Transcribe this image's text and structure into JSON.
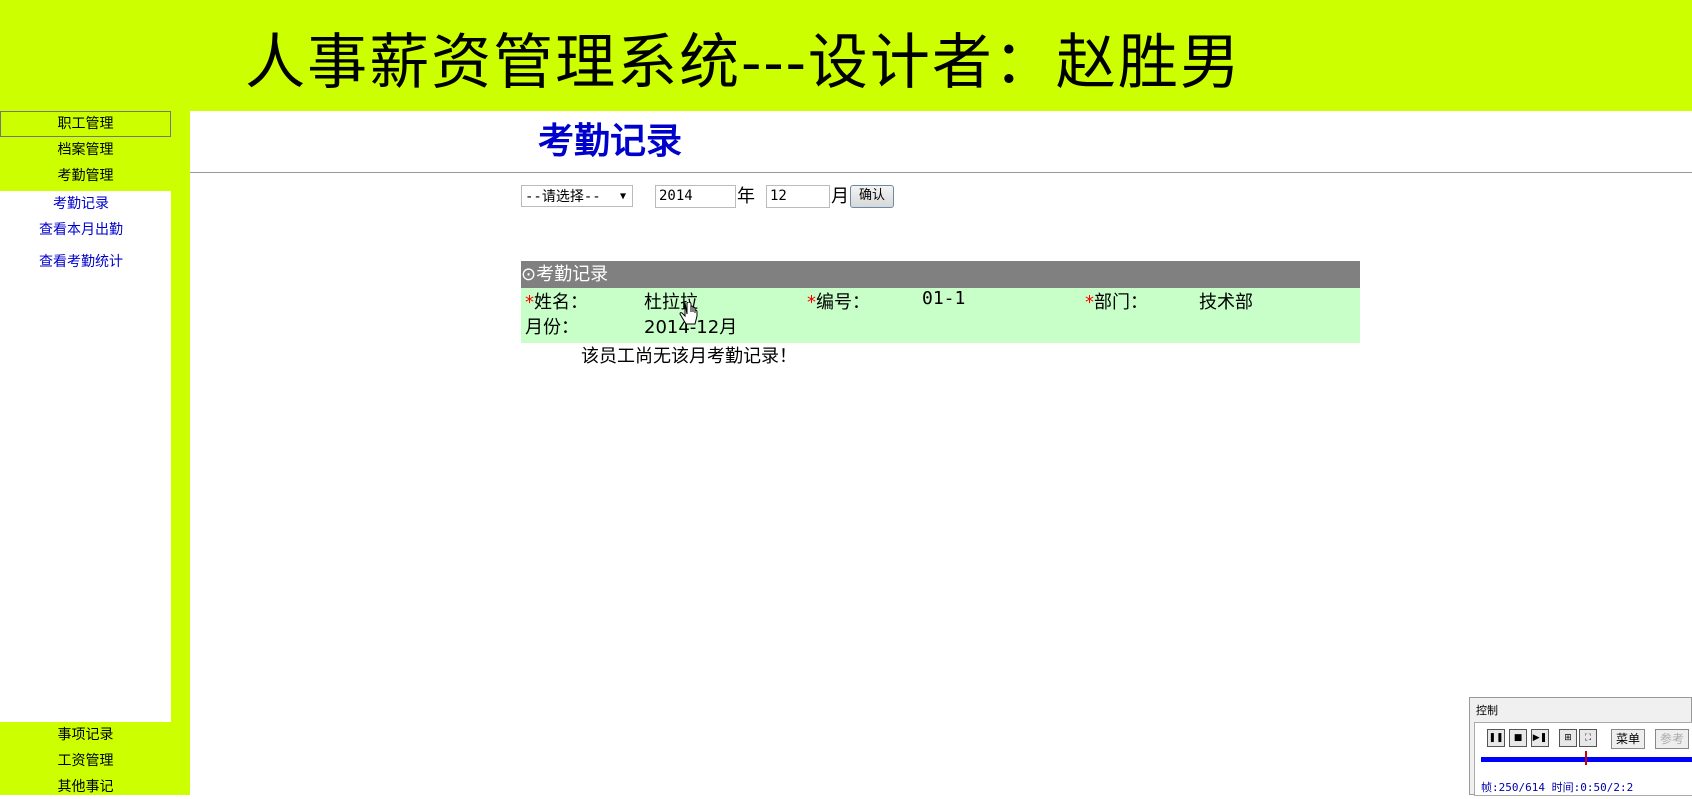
{
  "banner": {
    "title": "人事薪资管理系统---设计者：赵胜男"
  },
  "sidebar": {
    "top_items": [
      "职工管理",
      "档案管理",
      "考勤管理"
    ],
    "sub_items": [
      "考勤记录",
      "查看本月出勤",
      "查看考勤统计"
    ],
    "bottom_items": [
      "事项记录",
      "工资管理",
      "其他事记"
    ]
  },
  "main": {
    "title": "考勤记录",
    "select_value": "--请选择--",
    "year_value": "2014",
    "year_unit": "年",
    "month_value": "12",
    "month_unit": "月",
    "confirm_label": "确认"
  },
  "record": {
    "header": "⊙考勤记录",
    "name_label": "姓名：",
    "name_value": "杜拉拉",
    "id_label": "编号：",
    "id_value": "01-1",
    "dept_label": "部门：",
    "dept_value": "技术部",
    "month_label": "月份：",
    "month_value": "2014-12月",
    "star": "*",
    "note": "该员工尚无该月考勤记录！"
  },
  "control": {
    "title": "控制",
    "menu_label": "菜单",
    "extra_label": "参考",
    "status": "帧:250/614 时间:0:50/2:2"
  },
  "colors": {
    "accent": "#ccff00",
    "title_blue": "#0000cc",
    "record_bg": "#c8ffc8",
    "header_gray": "#808080"
  }
}
